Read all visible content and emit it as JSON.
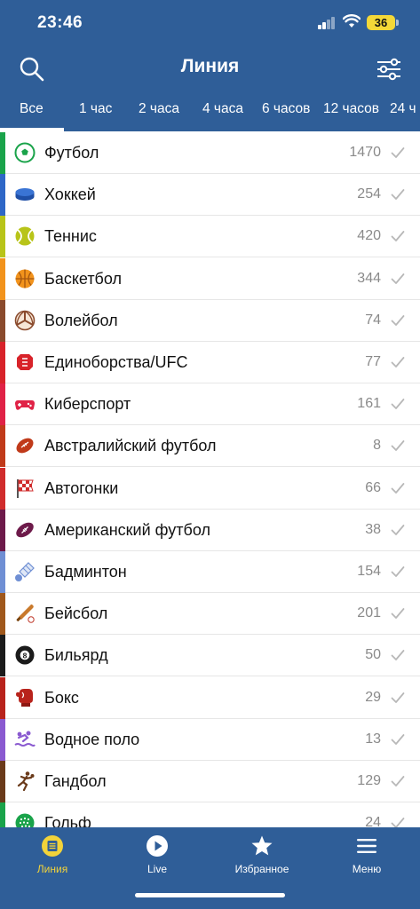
{
  "status_bar": {
    "time": "23:46",
    "battery": "36"
  },
  "header": {
    "title": "Линия"
  },
  "time_filters": [
    "Все",
    "1 час",
    "2 часа",
    "4 часа",
    "6 часов",
    "12 часов",
    "24 ч"
  ],
  "sports": [
    {
      "name": "Футбол",
      "count": "1470",
      "color": "#1aa34a",
      "icon": "soccer-ball-icon"
    },
    {
      "name": "Хоккей",
      "count": "254",
      "color": "#2e67c7",
      "icon": "hockey-puck-icon"
    },
    {
      "name": "Теннис",
      "count": "420",
      "color": "#b8c419",
      "icon": "tennis-ball-icon"
    },
    {
      "name": "Баскетбол",
      "count": "344",
      "color": "#f2931c",
      "icon": "basketball-icon"
    },
    {
      "name": "Волейбол",
      "count": "74",
      "color": "#8a4a2c",
      "icon": "volleyball-icon"
    },
    {
      "name": "Единоборства/UFC",
      "count": "77",
      "color": "#d8232a",
      "icon": "ufc-octagon-icon"
    },
    {
      "name": "Киберспорт",
      "count": "161",
      "color": "#e02246",
      "icon": "gamepad-icon"
    },
    {
      "name": "Австралийский футбол",
      "count": "8",
      "color": "#c03a1a",
      "icon": "australian-football-icon"
    },
    {
      "name": "Автогонки",
      "count": "66",
      "color": "#d02c2c",
      "icon": "checkered-flag-icon"
    },
    {
      "name": "Американский футбол",
      "count": "38",
      "color": "#6d1a4a",
      "icon": "american-football-icon"
    },
    {
      "name": "Бадминтон",
      "count": "154",
      "color": "#6f8fd4",
      "icon": "shuttlecock-icon"
    },
    {
      "name": "Бейсбол",
      "count": "201",
      "color": "#a0581c",
      "icon": "baseball-bat-icon"
    },
    {
      "name": "Бильярд",
      "count": "50",
      "color": "#1b1b1b",
      "icon": "billiard-ball-icon"
    },
    {
      "name": "Бокс",
      "count": "29",
      "color": "#b8231c",
      "icon": "boxing-glove-icon"
    },
    {
      "name": "Водное поло",
      "count": "13",
      "color": "#8a5ad0",
      "icon": "water-polo-icon"
    },
    {
      "name": "Гандбол",
      "count": "129",
      "color": "#6a3a1a",
      "icon": "handball-icon"
    },
    {
      "name": "Гольф",
      "count": "24",
      "color": "#1aa34a",
      "icon": "golf-ball-icon"
    }
  ],
  "bottom_nav": [
    {
      "label": "Линия",
      "icon": "line-coupon-icon",
      "active": true
    },
    {
      "label": "Live",
      "icon": "play-icon",
      "active": false
    },
    {
      "label": "Избранное",
      "icon": "star-icon",
      "active": false
    },
    {
      "label": "Меню",
      "icon": "menu-icon",
      "active": false
    }
  ],
  "colors": {
    "header_bg": "#2f5e98",
    "active_accent": "#f2d33a"
  }
}
